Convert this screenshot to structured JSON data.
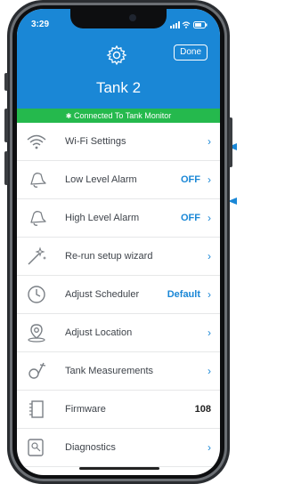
{
  "status_bar": {
    "time": "3:29"
  },
  "header": {
    "title": "Tank 2",
    "done_label": "Done"
  },
  "connection_banner": {
    "text": "Connected To Tank Monitor"
  },
  "colors": {
    "header_bg": "#1a87d6",
    "banner_bg": "#25b94d",
    "accent": "#1a87d6"
  },
  "settings": [
    {
      "label": "Wi-Fi Settings",
      "value": "",
      "icon": "wifi-icon"
    },
    {
      "label": "Low Level Alarm",
      "value": "OFF",
      "icon": "bell-icon"
    },
    {
      "label": "High Level Alarm",
      "value": "OFF",
      "icon": "bell-icon"
    },
    {
      "label": "Re-run setup wizard",
      "value": "",
      "icon": "magic-wand-icon"
    },
    {
      "label": "Adjust Scheduler",
      "value": "Default",
      "icon": "clock-icon"
    },
    {
      "label": "Adjust Location",
      "value": "",
      "icon": "location-pin-icon"
    },
    {
      "label": "Tank Measurements",
      "value": "",
      "icon": "measure-icon"
    },
    {
      "label": "Firmware",
      "value": "108",
      "icon": "firmware-icon"
    },
    {
      "label": "Diagnostics",
      "value": "",
      "icon": "diagnostics-icon"
    }
  ]
}
